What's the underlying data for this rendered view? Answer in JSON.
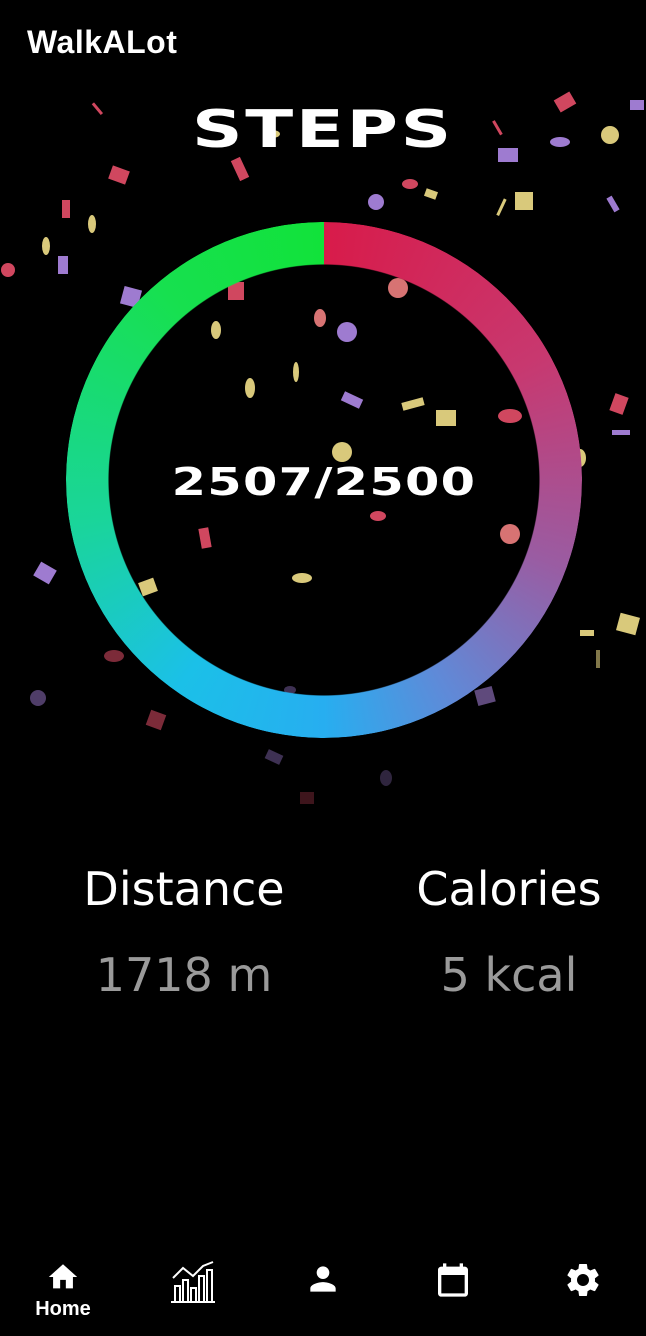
{
  "app": {
    "title": "WalkALot"
  },
  "steps": {
    "heading": "STEPS",
    "current": 2507,
    "goal": 2500,
    "display": "2507/2500"
  },
  "stats": {
    "distance_label": "Distance",
    "distance_value": "1718 m",
    "calories_label": "Calories",
    "calories_value": "5 kcal"
  },
  "nav": {
    "items": [
      {
        "label": "Home",
        "icon": "home-icon",
        "active": true
      },
      {
        "label": "",
        "icon": "chart-icon",
        "active": false
      },
      {
        "label": "",
        "icon": "profile-icon",
        "active": false
      },
      {
        "label": "",
        "icon": "calendar-icon",
        "active": false
      },
      {
        "label": "",
        "icon": "settings-icon",
        "active": false
      }
    ]
  },
  "colors": {
    "background": "#000000",
    "ring_start": "#d81b4a",
    "ring_mid": "#27aef0",
    "ring_end": "#11e23a",
    "value_gray": "#9a9a9a"
  }
}
